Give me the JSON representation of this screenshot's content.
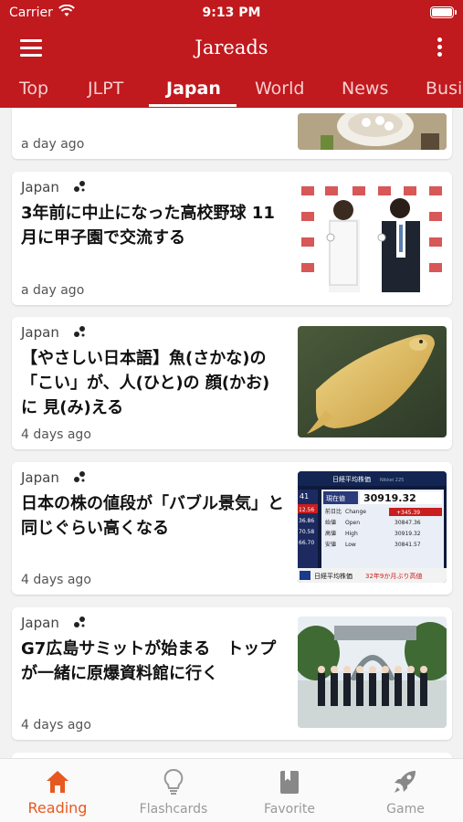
{
  "status_bar": {
    "carrier": "Carrier",
    "time": "9:13 PM"
  },
  "app_bar": {
    "title": "Jareads"
  },
  "tabs": [
    {
      "label": "Top"
    },
    {
      "label": "JLPT"
    },
    {
      "label": "Japan"
    },
    {
      "label": "World"
    },
    {
      "label": "News"
    },
    {
      "label": "Busi"
    }
  ],
  "active_tab": "Japan",
  "cards": [
    {
      "time": "a day ago"
    },
    {
      "source": "Japan",
      "headline": "3年前に中止になった高校野球 11月に甲子園で交流する",
      "time": "a day ago"
    },
    {
      "source": "Japan",
      "headline": "【やさしい日本語】魚(さかな)の「こい」が、人(ひと)の 顔(かお)に 見(み)える",
      "time": "4 days ago"
    },
    {
      "source": "Japan",
      "headline": "日本の株の値段が「バブル景気」と同じぐらい高くなる",
      "time": "4 days ago",
      "screen": {
        "label": "日経平均株価",
        "sub": "Nikkei 225",
        "now_label": "現在値",
        "value": "30919.32",
        "side": [
          "41",
          "12.56",
          "36.86",
          "70.58",
          "66.70"
        ],
        "rows": [
          {
            "jp": "前日比",
            "en": "Change",
            "val": "+345.39"
          },
          {
            "jp": "始値",
            "en": "Open",
            "val": "30847.36"
          },
          {
            "jp": "高値",
            "en": "High",
            "val": "30919.32"
          },
          {
            "jp": "安値",
            "en": "Low",
            "val": "30841.57"
          }
        ],
        "ticker_label": "日経平均株価",
        "ticker_highlight": "32年9か月ぶり高値"
      }
    },
    {
      "source": "Japan",
      "headline": "G7広島サミットが始まる　トップが一緒に原爆資料館に行く",
      "time": "4 days ago"
    }
  ],
  "bottom_nav": [
    {
      "label": "Reading",
      "icon": "home-icon"
    },
    {
      "label": "Flashcards",
      "icon": "lightbulb-icon"
    },
    {
      "label": "Favorite",
      "icon": "bookmark-icon"
    },
    {
      "label": "Game",
      "icon": "rocket-icon"
    }
  ],
  "colors": {
    "primary": "#c0191e",
    "accent": "#e8591f",
    "inactive": "#999999"
  }
}
